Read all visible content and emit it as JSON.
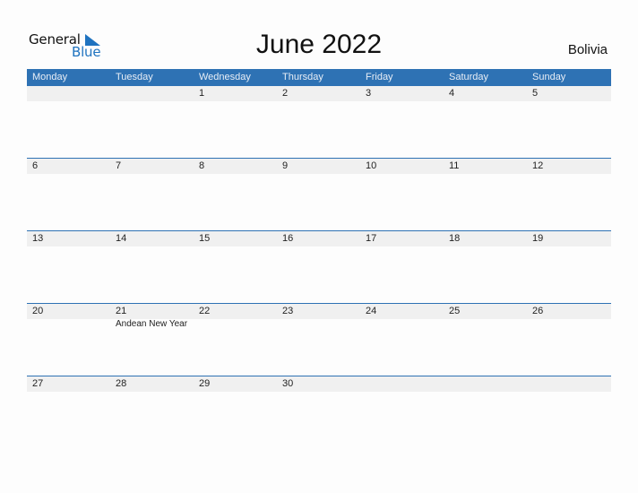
{
  "logo": {
    "line1": "General",
    "line2": "Blue",
    "accent": "#1f73c0"
  },
  "title": "June 2022",
  "country": "Bolivia",
  "colors": {
    "header_bg": "#2e72b4",
    "date_strip": "#f0f0f0"
  },
  "weekdays": [
    "Monday",
    "Tuesday",
    "Wednesday",
    "Thursday",
    "Friday",
    "Saturday",
    "Sunday"
  ],
  "weeks": [
    [
      {
        "day": ""
      },
      {
        "day": ""
      },
      {
        "day": "1"
      },
      {
        "day": "2"
      },
      {
        "day": "3"
      },
      {
        "day": "4"
      },
      {
        "day": "5"
      }
    ],
    [
      {
        "day": "6"
      },
      {
        "day": "7"
      },
      {
        "day": "8"
      },
      {
        "day": "9"
      },
      {
        "day": "10"
      },
      {
        "day": "11"
      },
      {
        "day": "12"
      }
    ],
    [
      {
        "day": "13"
      },
      {
        "day": "14"
      },
      {
        "day": "15"
      },
      {
        "day": "16"
      },
      {
        "day": "17"
      },
      {
        "day": "18"
      },
      {
        "day": "19"
      }
    ],
    [
      {
        "day": "20"
      },
      {
        "day": "21",
        "holiday": "Andean New Year"
      },
      {
        "day": "22"
      },
      {
        "day": "23"
      },
      {
        "day": "24"
      },
      {
        "day": "25"
      },
      {
        "day": "26"
      }
    ],
    [
      {
        "day": "27"
      },
      {
        "day": "28"
      },
      {
        "day": "29"
      },
      {
        "day": "30"
      },
      {
        "day": ""
      },
      {
        "day": ""
      },
      {
        "day": ""
      }
    ]
  ]
}
